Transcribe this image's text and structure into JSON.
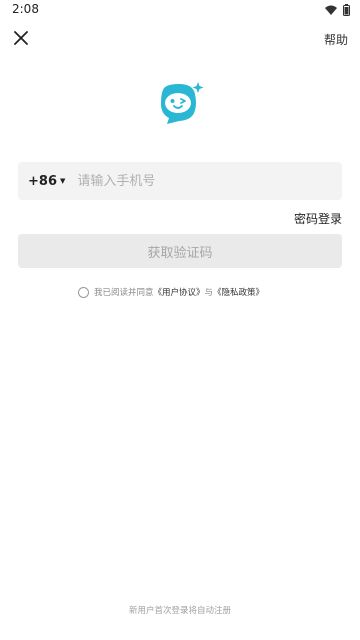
{
  "status_bar": {
    "time": "2:08",
    "icons": [
      "wifi-icon",
      "battery-icon"
    ]
  },
  "header": {
    "close_icon": "close-icon",
    "help_label": "帮助"
  },
  "logo": {
    "icon": "smiling-face-logo-icon",
    "accent_color": "#29b7d3"
  },
  "phone": {
    "country_code": "+86",
    "placeholder": "请输入手机号",
    "value": ""
  },
  "password_login_label": "密码登录",
  "get_code_button_label": "获取验证码",
  "agreement": {
    "prefix": "我已阅读并同意",
    "user_agreement": "《用户协议》",
    "connector": "与",
    "privacy_policy": "《隐私政策》",
    "checked": false
  },
  "footer_note": "新用户首次登录将自动注册",
  "colors": {
    "background": "#ffffff",
    "input_bg": "#f3f3f3",
    "button_disabled_bg": "#eaeaea",
    "button_disabled_text": "#a6a6a6"
  }
}
